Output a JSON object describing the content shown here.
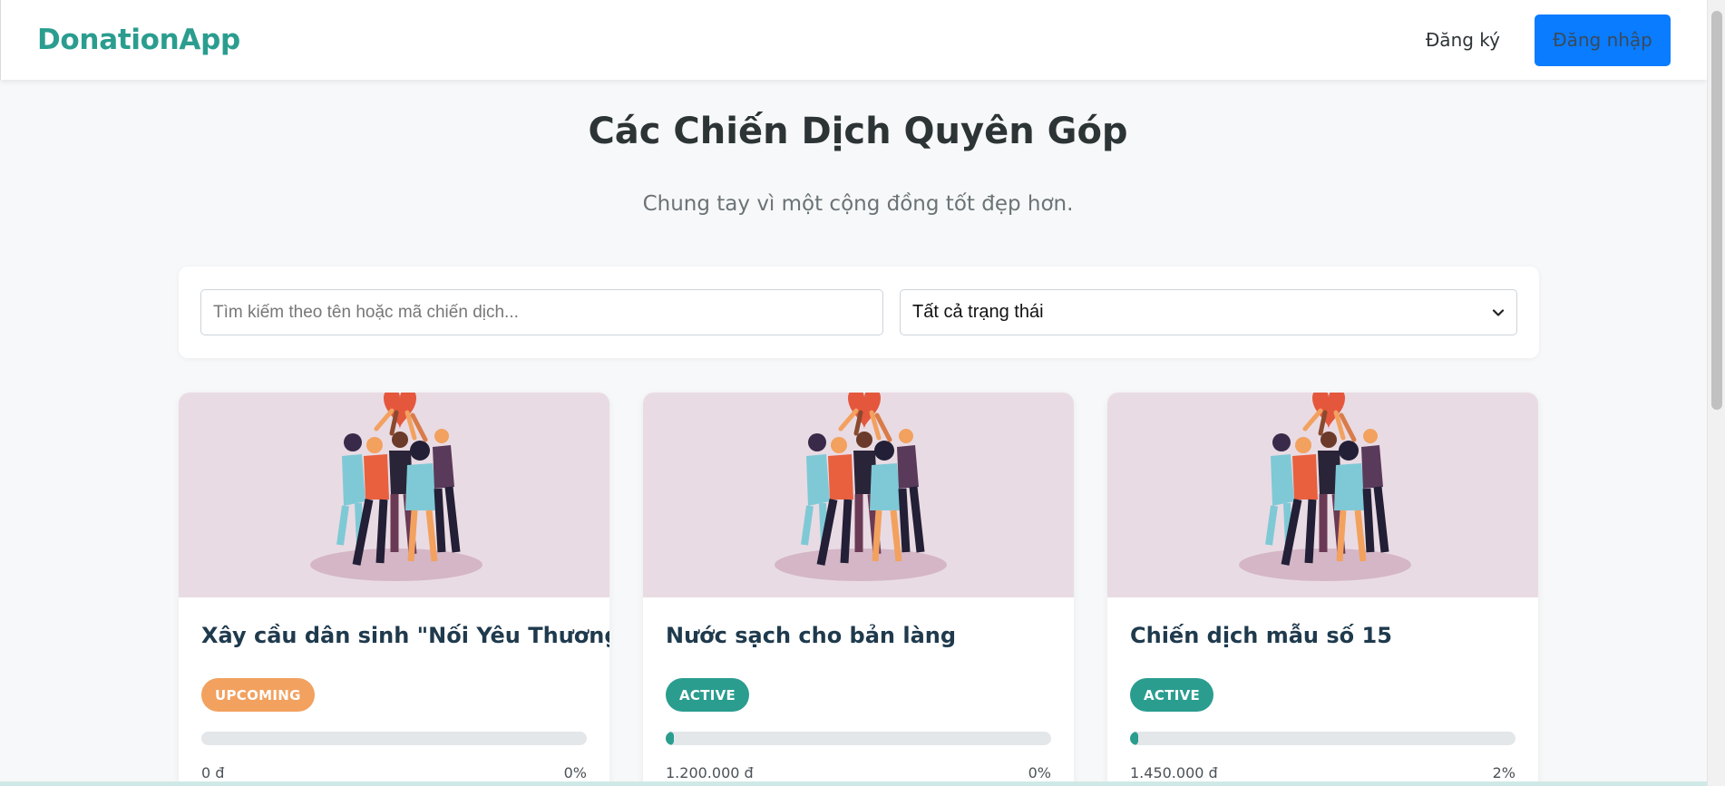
{
  "header": {
    "brand": "DonationApp",
    "register_label": "Đăng ký",
    "login_label": "Đăng nhập"
  },
  "hero": {
    "title": "Các Chiến Dịch Quyên Góp",
    "subtitle": "Chung tay vì một cộng đồng tốt đẹp hơn."
  },
  "filters": {
    "search_placeholder": "Tìm kiếm theo tên hoặc mã chiến dịch...",
    "status_selected": "Tất cả trạng thái"
  },
  "campaigns": [
    {
      "title": "Xây cầu dân sinh \"Nối Yêu Thương\"",
      "status": "UPCOMING",
      "raised": "0 đ",
      "percent_label": "0%",
      "progress": 0.0
    },
    {
      "title": "Nước sạch cho bản làng",
      "status": "ACTIVE",
      "raised": "1.200.000 đ",
      "percent_label": "0%",
      "progress": 0.005
    },
    {
      "title": "Chiến dịch mẫu số 15",
      "status": "ACTIVE",
      "raised": "1.450.000 đ",
      "percent_label": "2%",
      "progress": 0.02
    }
  ],
  "colors": {
    "brand": "#2a9d8f",
    "primary_button": "#0a7cff",
    "upcoming_badge": "#f2a15f",
    "active_badge": "#2a9d8f",
    "card_image_bg": "#e9dbe3"
  },
  "icons": {
    "select_arrow": "chevron-down-icon",
    "card_illustration": "people-lifting-heart-illustration"
  }
}
